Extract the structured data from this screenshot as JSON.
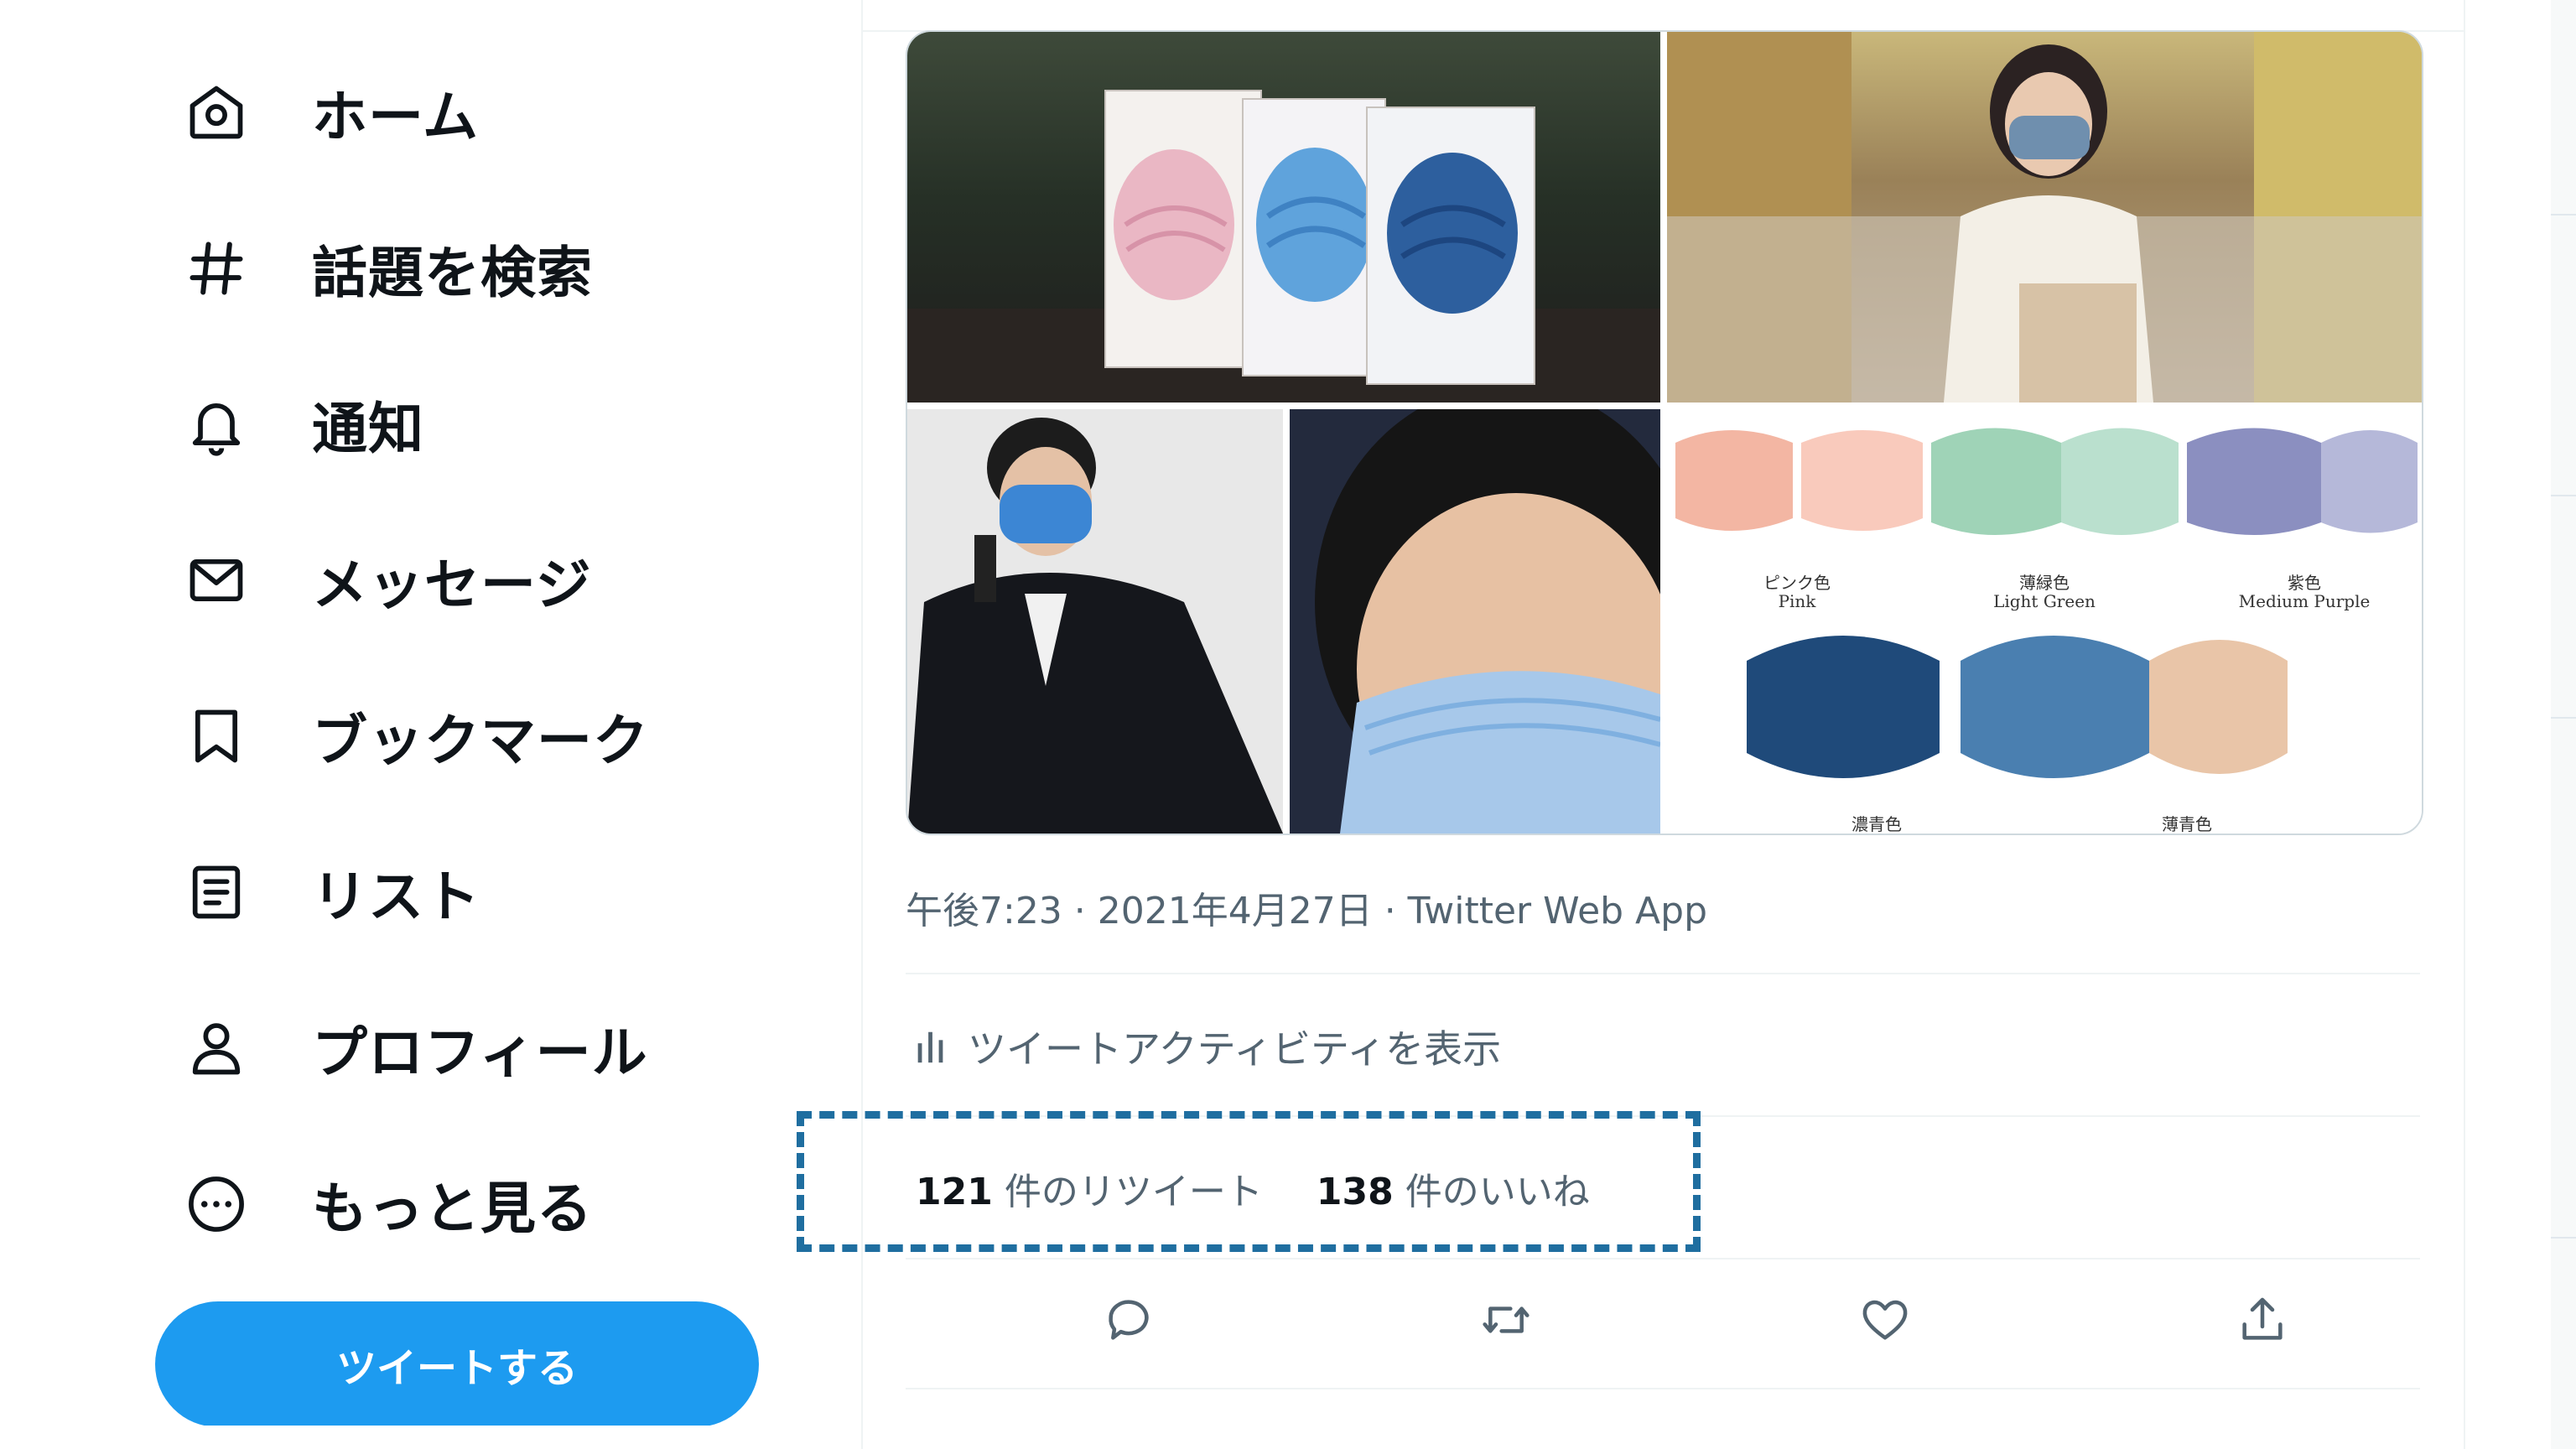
{
  "nav": {
    "items": [
      {
        "label": "ホーム",
        "icon": "home-icon"
      },
      {
        "label": "話題を検索",
        "icon": "hashtag-icon"
      },
      {
        "label": "通知",
        "icon": "bell-icon"
      },
      {
        "label": "メッセージ",
        "icon": "envelope-icon"
      },
      {
        "label": "ブックマーク",
        "icon": "bookmark-icon"
      },
      {
        "label": "リスト",
        "icon": "list-icon"
      },
      {
        "label": "プロフィール",
        "icon": "person-icon"
      },
      {
        "label": "もっと見る",
        "icon": "more-circle-icon"
      }
    ],
    "tweet_button": "ツイートする"
  },
  "tweet": {
    "media": {
      "catalog_labels": [
        {
          "jp": "ピンク色",
          "en": "Pink"
        },
        {
          "jp": "薄緑色",
          "en": "Light Green"
        },
        {
          "jp": "紫色",
          "en": "Medium Purple"
        },
        {
          "jp": "濃青色",
          "en": ""
        },
        {
          "jp": "薄青色",
          "en": ""
        }
      ]
    },
    "timestamp": "午後7:23 · 2021年4月27日 · Twitter Web App",
    "activity_label": "ツイートアクティビティを表示",
    "stats": {
      "retweets_count": "121",
      "retweets_label": "件のリツイート",
      "likes_count": "138",
      "likes_label": "件のいいね"
    },
    "actions": [
      "reply-icon",
      "retweet-icon",
      "like-icon",
      "share-icon"
    ]
  },
  "colors": {
    "accent": "#1d9bf0",
    "secondary_text": "#536471",
    "highlight_border": "#1f6ea0"
  }
}
